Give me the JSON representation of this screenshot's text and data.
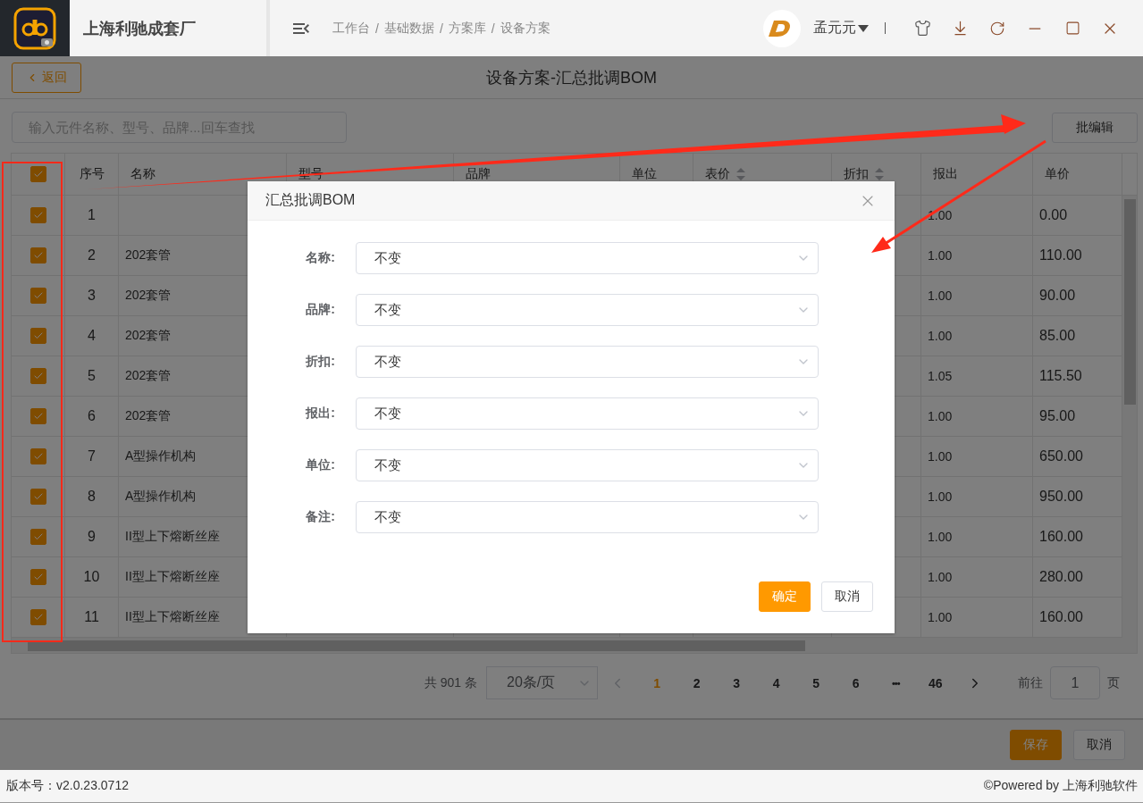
{
  "app": {
    "company": "上海利驰成套厂"
  },
  "breadcrumb": {
    "separator": "/",
    "items": [
      "工作台",
      "基础数据",
      "方案库",
      "设备方案"
    ]
  },
  "user": {
    "name": "孟元元"
  },
  "page": {
    "back": "返回",
    "title": "设备方案-汇总批调BOM"
  },
  "search": {
    "placeholder": "输入元件名称、型号、品牌...回车查找"
  },
  "batch_edit": "批编辑",
  "table": {
    "all_checked": true,
    "columns": [
      {
        "label": "序号",
        "sortable": false
      },
      {
        "label": "名称",
        "sortable": false
      },
      {
        "label": "型号",
        "sortable": false
      },
      {
        "label": "品牌",
        "sortable": false
      },
      {
        "label": "单位",
        "sortable": false
      },
      {
        "label": "表价",
        "sortable": true
      },
      {
        "label": "折扣",
        "sortable": true
      },
      {
        "label": "报出",
        "sortable": false
      },
      {
        "label": "单价",
        "sortable": false
      }
    ],
    "rows": [
      {
        "checked": true,
        "no": "1",
        "quote": "1.00",
        "price": "0.00"
      },
      {
        "checked": true,
        "no": "2",
        "name": "202套管",
        "quote": "1.00",
        "price": "110.00"
      },
      {
        "checked": true,
        "no": "3",
        "name": "202套管",
        "quote": "1.00",
        "price": "90.00"
      },
      {
        "checked": true,
        "no": "4",
        "name": "202套管",
        "quote": "1.00",
        "price": "85.00"
      },
      {
        "checked": true,
        "no": "5",
        "name": "202套管",
        "quote": "1.05",
        "price": "115.50"
      },
      {
        "checked": true,
        "no": "6",
        "name": "202套管",
        "quote": "1.00",
        "price": "95.00"
      },
      {
        "checked": true,
        "no": "7",
        "name": "A型操作机构",
        "quote": "1.00",
        "price": "650.00"
      },
      {
        "checked": true,
        "no": "8",
        "name": "A型操作机构",
        "quote": "1.00",
        "price": "950.00"
      },
      {
        "checked": true,
        "no": "9",
        "name": "II型上下熔断丝座",
        "quote": "1.00",
        "price": "160.00"
      },
      {
        "checked": true,
        "no": "10",
        "name": "II型上下熔断丝座",
        "quote": "1.00",
        "price": "280.00"
      },
      {
        "checked": true,
        "no": "11",
        "name": "II型上下熔断丝座",
        "quote": "1.00",
        "price": "160.00"
      }
    ]
  },
  "pagination": {
    "total": "共 901 条",
    "page_size": "20条/页",
    "pages": [
      {
        "label": "1",
        "kind": "page",
        "selected": true
      },
      {
        "label": "2",
        "kind": "page",
        "selected": false
      },
      {
        "label": "3",
        "kind": "page",
        "selected": false
      },
      {
        "label": "4",
        "kind": "page",
        "selected": false
      },
      {
        "label": "5",
        "kind": "page",
        "selected": false
      },
      {
        "label": "6",
        "kind": "page",
        "selected": false
      },
      {
        "label": "•••",
        "kind": "more",
        "selected": false
      },
      {
        "label": "46",
        "kind": "page",
        "selected": false
      }
    ],
    "goto_label": "前往",
    "goto_value": "1",
    "goto_unit": "页"
  },
  "actions": {
    "save": "保存",
    "cancel": "取消"
  },
  "dialog": {
    "title": "汇总批调BOM",
    "fields": [
      {
        "label": "名称:",
        "value": "不变"
      },
      {
        "label": "品牌:",
        "value": "不变"
      },
      {
        "label": "折扣:",
        "value": "不变"
      },
      {
        "label": "报出:",
        "value": "不变"
      },
      {
        "label": "单位:",
        "value": "不变"
      },
      {
        "label": "备注:",
        "value": "不变"
      }
    ],
    "confirm": "确定",
    "cancel": "取消"
  },
  "footer": {
    "version": "版本号：v2.0.23.0712",
    "powered": "©Powered by 上海利驰软件"
  }
}
